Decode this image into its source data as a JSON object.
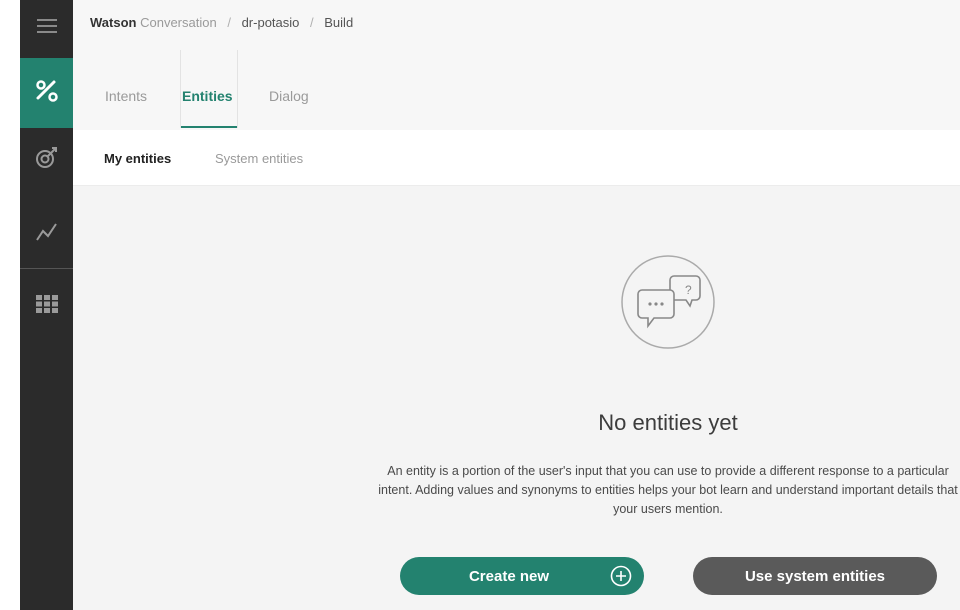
{
  "breadcrumb": {
    "brand": "Watson",
    "product": "Conversation",
    "separator": "/",
    "workspace": "dr-potasio",
    "section": "Build"
  },
  "sidebar": {
    "items": [
      {
        "name": "menu",
        "icon": "hamburger-menu-icon"
      },
      {
        "name": "build",
        "icon": "tools-icon",
        "active": true
      },
      {
        "name": "improve",
        "icon": "target-icon"
      },
      {
        "name": "analytics",
        "icon": "trend-line-icon"
      },
      {
        "name": "deploy",
        "icon": "grid-icon"
      }
    ]
  },
  "tabs": [
    {
      "label": "Intents"
    },
    {
      "label": "Entities",
      "active": true
    },
    {
      "label": "Dialog"
    }
  ],
  "subtabs": [
    {
      "label": "My entities",
      "active": true
    },
    {
      "label": "System entities"
    }
  ],
  "empty_state": {
    "icon": "chat-bubbles-icon",
    "title": "No entities yet",
    "description": "An entity is a portion of the user's input that you can use to provide a different response to a particular intent. Adding values and synonyms to entities helps your bot learn and understand important details that your users mention.",
    "create_label": "Create new",
    "system_label": "Use system entities"
  },
  "colors": {
    "accent": "#23826f",
    "rail": "#2b2b2b",
    "secondary_button": "#5a5a5a"
  }
}
